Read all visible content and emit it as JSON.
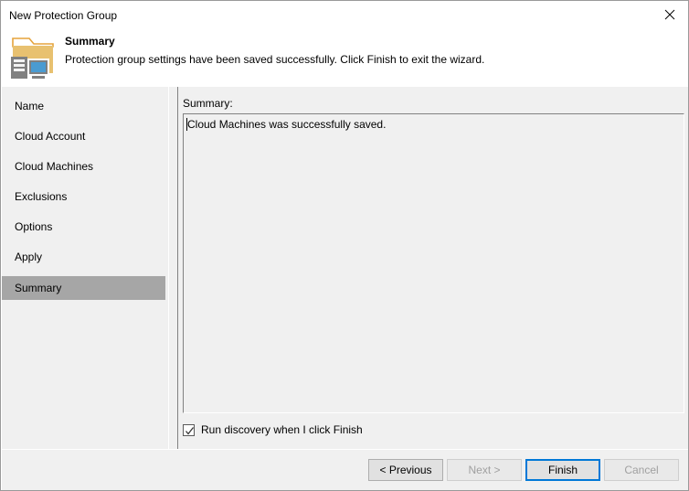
{
  "window": {
    "title": "New Protection Group",
    "close_icon": "close-icon"
  },
  "header": {
    "icon": "protection-group-icon",
    "title": "Summary",
    "description": "Protection group settings have been saved successfully. Click Finish to exit the wizard."
  },
  "sidebar": {
    "items": [
      {
        "label": "Name",
        "active": false
      },
      {
        "label": "Cloud Account",
        "active": false
      },
      {
        "label": "Cloud Machines",
        "active": false
      },
      {
        "label": "Exclusions",
        "active": false
      },
      {
        "label": "Options",
        "active": false
      },
      {
        "label": "Apply",
        "active": false
      },
      {
        "label": "Summary",
        "active": true
      }
    ]
  },
  "content": {
    "summary_label": "Summary:",
    "summary_text": "Cloud Machines was successfully saved.",
    "checkbox": {
      "label": "Run discovery when I click Finish",
      "checked": true
    }
  },
  "footer": {
    "buttons": [
      {
        "label": "< Previous",
        "state": "enabled"
      },
      {
        "label": "Next >",
        "state": "disabled"
      },
      {
        "label": "Finish",
        "state": "default"
      },
      {
        "label": "Cancel",
        "state": "disabled"
      }
    ]
  },
  "colors": {
    "accent": "#0078d7",
    "panel": "#f0f0f0",
    "selection": "#a6a6a6",
    "folder": "#e8c170",
    "folder_outline": "#e5a33c",
    "server_gray": "#808080",
    "screen_blue": "#4a9bd1"
  }
}
